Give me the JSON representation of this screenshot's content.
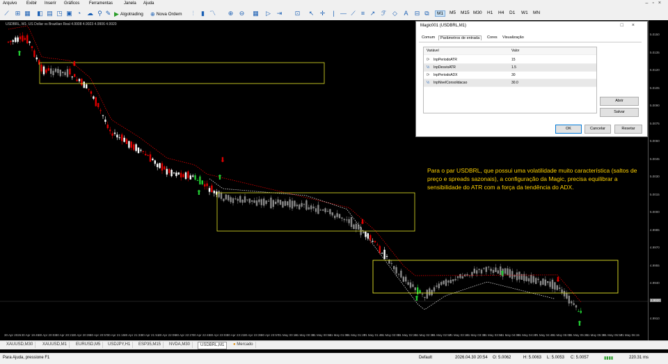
{
  "menu": [
    "Arquivo",
    "Exibir",
    "Inserir",
    "Gráficos",
    "Ferramentas",
    "Janela",
    "Ajuda"
  ],
  "toolbar": {
    "algotrading": "Algotrading",
    "new_order": "Nova Ordem",
    "timeframes": [
      "M1",
      "M5",
      "M15",
      "M30",
      "H1",
      "H4",
      "D1",
      "W1",
      "MN"
    ],
    "active_timeframe": "M1"
  },
  "chart": {
    "title": "USDBRL, M1: US Dollar vs Brazilian Real  4.9908 4.9923 4.9906 4.9920",
    "price_labels": [
      "5.0150",
      "5.0135",
      "5.0120",
      "5.0105",
      "5.0090",
      "5.0075",
      "5.0060",
      "5.0045",
      "5.0030",
      "5.0015",
      "5.0000",
      "4.9985",
      "4.9970",
      "4.9955",
      "4.9940",
      "4.9925",
      "4.9910"
    ],
    "current_price": "4.9920",
    "time_labels": [
      "30 Apr 2026",
      "30 Apr 19:45",
      "30 Apr 20:03",
      "30 Apr 20:21",
      "30 Apr 20:39",
      "30 Apr 20:57",
      "30 Apr 21:15",
      "30 Apr 21:33",
      "30 Apr 21:51",
      "30 Apr 22:09",
      "30 Apr 22:27",
      "30 Apr 22:45",
      "30 Apr 23:03",
      "30 Apr 23:21",
      "30 Apr 23:39",
      "30 Apr 23:57",
      "01 May 00:15",
      "01 May 00:33",
      "01 May 00:51",
      "01 May 01:09",
      "01 May 01:27",
      "01 May 01:45",
      "01 May 02:03",
      "01 May 02:21",
      "01 May 02:39",
      "01 May 02:57",
      "01 May 03:15",
      "01 May 03:33",
      "01 May 03:51",
      "01 May 04:09",
      "01 May 04:27",
      "01 May 04:45",
      "01 May 05:03",
      "01 May 05:21",
      "01 May 05:39",
      "01 May 05:57",
      "01 May 06:15"
    ],
    "annotation": "Para o par USDBRL, que possui uma volatilidade muito característica (saltos de preço e spreads sazonais), a configuração da Magic, precisa equilibrar a sensibilidade do ATR com a força da tendência do ADX."
  },
  "dialog": {
    "title": "Magic001 (USDBRL,M1)",
    "tabs": [
      "Comum",
      "Parâmetros de entrada",
      "Cores",
      "Visualização"
    ],
    "active_tab": "Parâmetros de entrada",
    "col_variable": "Variável",
    "col_value": "Valor",
    "params": [
      {
        "name": "InpPeriodoATR",
        "value": "15"
      },
      {
        "name": "InpDesvioATR",
        "value": "1.5"
      },
      {
        "name": "InpPeriodoADX",
        "value": "30"
      },
      {
        "name": "InpNivelConsolidacao",
        "value": "30.0"
      }
    ],
    "btn_open": "Abrir",
    "btn_save": "Salvar",
    "btn_ok": "OK",
    "btn_cancel": "Cancelar",
    "btn_reset": "Resetar"
  },
  "tabs": [
    "XAUUSD,M30",
    "XAUUSD,M1",
    "EURUSD,M5",
    "USDJPY,H1",
    "ESP35,M15",
    "NVDA,M30",
    "USDBRL,M1",
    "Mercado"
  ],
  "active_tab": "USDBRL,M1",
  "status": {
    "help": "Para Ajuda, pressione F1",
    "profile": "Default",
    "datetime": "2026.04.30 20:54",
    "open": "O: 5.0062",
    "high": "H: 5.0063",
    "low": "L: 5.0053",
    "close": "C: 5.0057",
    "traffic": "220.31 ms"
  },
  "colors": {
    "bull": "#ffffff",
    "bear": "#e00000",
    "consolidation": "#888888",
    "trend_up": "#22cc33",
    "box": "#e6e62a",
    "annotation": "#ffd200"
  }
}
